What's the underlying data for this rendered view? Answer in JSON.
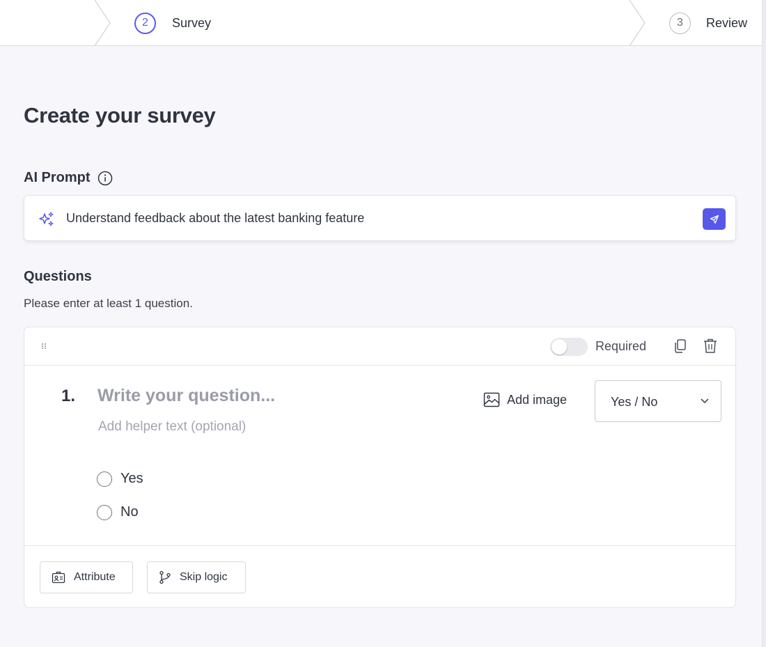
{
  "stepper": {
    "steps": [
      {
        "number": "2",
        "label": "Survey",
        "state": "active"
      },
      {
        "number": "3",
        "label": "Review",
        "state": "upcoming"
      }
    ]
  },
  "page_title": "Create your survey",
  "ai_prompt": {
    "label": "AI Prompt",
    "value": "Understand feedback about the latest banking feature"
  },
  "questions": {
    "title": "Questions",
    "hint": "Please enter at least 1 question.",
    "items": [
      {
        "number": "1.",
        "placeholder": "Write your question...",
        "helper_placeholder": "Add helper text (optional)",
        "required_label": "Required",
        "required": false,
        "add_image_label": "Add image",
        "type": "Yes / No",
        "options": [
          "Yes",
          "No"
        ]
      }
    ],
    "footer_buttons": {
      "attribute": "Attribute",
      "skip_logic": "Skip logic"
    }
  },
  "colors": {
    "accent": "#5757ea",
    "background": "#f7f7fb"
  }
}
